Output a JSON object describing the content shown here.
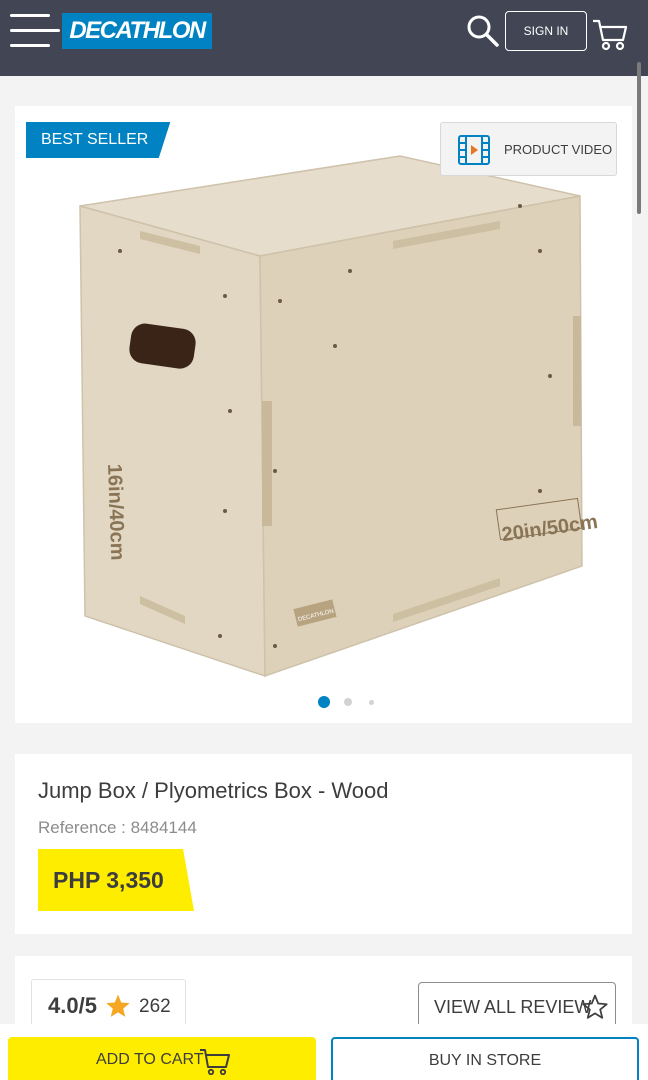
{
  "header": {
    "logo_text": "DECATHLON",
    "signin_label": "SIGN IN"
  },
  "gallery": {
    "badge": "BEST SELLER",
    "video_label": "PRODUCT VIDEO",
    "active_slide": 1,
    "slide_count": 3,
    "box_markings": {
      "side": "16in/40cm",
      "front": "20in/50cm",
      "brand": "DECATHLON"
    }
  },
  "product": {
    "title": "Jump Box / Plyometrics Box - Wood",
    "reference": "Reference : 8484144",
    "price": "PHP 3,350"
  },
  "reviews": {
    "rating": "4.0/5",
    "count": "262",
    "view_all_label": "VIEW ALL REVIEW"
  },
  "actions": {
    "add_to_cart": "ADD TO CART",
    "buy_in_store": "BUY IN STORE"
  },
  "colors": {
    "header_bg": "#424553",
    "brand_blue": "#0082c3",
    "price_yellow": "#ffed00",
    "star_gold": "#f5a623"
  }
}
